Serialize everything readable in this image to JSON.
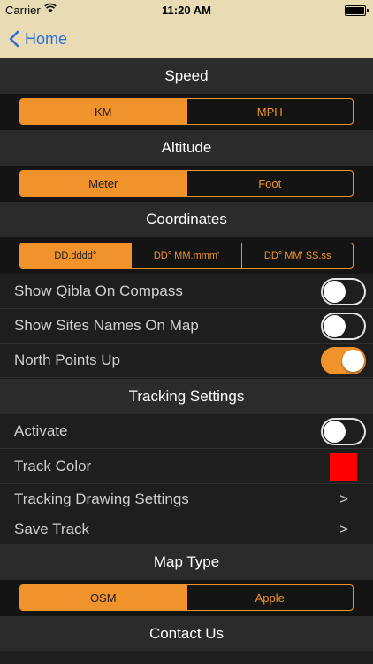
{
  "status_bar": {
    "carrier": "Carrier",
    "time": "11:20 AM"
  },
  "nav": {
    "back_label": "Home"
  },
  "speed": {
    "title": "Speed",
    "options": [
      "KM",
      "MPH"
    ],
    "selected": "KM"
  },
  "altitude": {
    "title": "Altitude",
    "options": [
      "Meter",
      "Foot"
    ],
    "selected": "Meter"
  },
  "coordinates": {
    "title": "Coordinates",
    "options": [
      "DD.dddd°",
      "DD° MM.mmm'",
      "DD° MM' SS.ss"
    ],
    "selected": "DD.dddd°"
  },
  "toggles": [
    {
      "label": "Show Qibla On Compass",
      "on": false
    },
    {
      "label": "Show Sites Names On Map",
      "on": false
    },
    {
      "label": "North Points Up",
      "on": true
    }
  ],
  "tracking": {
    "title": "Tracking Settings",
    "activate_label": "Activate",
    "activate_on": false,
    "track_color_label": "Track Color",
    "track_color": "#ff0000",
    "drawing_settings_label": "Tracking Drawing Settings",
    "save_track_label": "Save Track",
    "chevron": ">"
  },
  "map_type": {
    "title": "Map Type",
    "options": [
      "OSM",
      "Apple"
    ],
    "selected": "OSM"
  },
  "contact": {
    "title": "Contact Us"
  },
  "colors": {
    "accent": "#f0932b",
    "nav_bg": "#e9dcb4",
    "link": "#2e6fd6",
    "background": "#1b1b1b"
  }
}
